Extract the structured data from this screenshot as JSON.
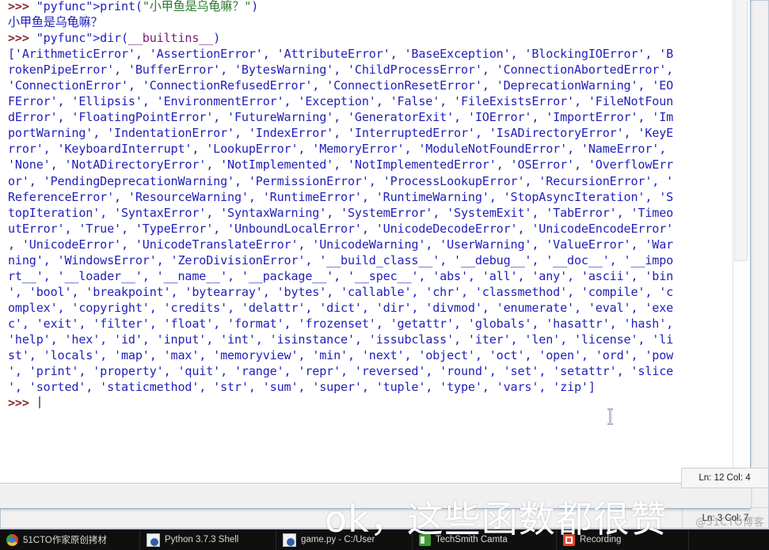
{
  "window": {
    "title": "Python 3.7.3 Shell",
    "status_main": "Ln: 12 Col: 4",
    "status_background": "Ln: 3 Col: 7"
  },
  "shell": {
    "lines": [
      {
        "id": "l1",
        "kind": "input",
        "prompt": ">>> ",
        "text": "print(\"小甲鱼是乌龟嘛？\")"
      },
      {
        "id": "l2",
        "kind": "output",
        "prompt": "",
        "text": "小甲鱼是乌龟嘛？"
      },
      {
        "id": "l3",
        "kind": "input",
        "prompt": ">>> ",
        "text": "dir(__builtins__)"
      },
      {
        "id": "l4",
        "kind": "output",
        "prompt": "",
        "text": "['ArithmeticError', 'AssertionError', 'AttributeError', 'BaseException', 'BlockingIOError', 'B"
      },
      {
        "id": "l5",
        "kind": "output",
        "prompt": "",
        "text": "rokenPipeError', 'BufferError', 'BytesWarning', 'ChildProcessError', 'ConnectionAbortedError',"
      },
      {
        "id": "l6",
        "kind": "output",
        "prompt": "",
        "text": "'ConnectionError', 'ConnectionRefusedError', 'ConnectionResetError', 'DeprecationWarning', 'EO"
      },
      {
        "id": "l7",
        "kind": "output",
        "prompt": "",
        "text": "FError', 'Ellipsis', 'EnvironmentError', 'Exception', 'False', 'FileExistsError', 'FileNotFoun"
      },
      {
        "id": "l8",
        "kind": "output",
        "prompt": "",
        "text": "dError', 'FloatingPointError', 'FutureWarning', 'GeneratorExit', 'IOError', 'ImportError', 'Im"
      },
      {
        "id": "l9",
        "kind": "output",
        "prompt": "",
        "text": "portWarning', 'IndentationError', 'IndexError', 'InterruptedError', 'IsADirectoryError', 'KeyE"
      },
      {
        "id": "l10",
        "kind": "output",
        "prompt": "",
        "text": "rror', 'KeyboardInterrupt', 'LookupError', 'MemoryError', 'ModuleNotFoundError', 'NameError',"
      },
      {
        "id": "l11",
        "kind": "output",
        "prompt": "",
        "text": "'None', 'NotADirectoryError', 'NotImplemented', 'NotImplementedError', 'OSError', 'OverflowErr"
      },
      {
        "id": "l12",
        "kind": "output",
        "prompt": "",
        "text": "or', 'PendingDeprecationWarning', 'PermissionError', 'ProcessLookupError', 'RecursionError', '"
      },
      {
        "id": "l13",
        "kind": "output",
        "prompt": "",
        "text": "ReferenceError', 'ResourceWarning', 'RuntimeError', 'RuntimeWarning', 'StopAsyncIteration', 'S"
      },
      {
        "id": "l14",
        "kind": "output",
        "prompt": "",
        "text": "topIteration', 'SyntaxError', 'SyntaxWarning', 'SystemError', 'SystemExit', 'TabError', 'Timeo"
      },
      {
        "id": "l15",
        "kind": "output",
        "prompt": "",
        "text": "utError', 'True', 'TypeError', 'UnboundLocalError', 'UnicodeDecodeError', 'UnicodeEncodeError'"
      },
      {
        "id": "l16",
        "kind": "output",
        "prompt": "",
        "text": ", 'UnicodeError', 'UnicodeTranslateError', 'UnicodeWarning', 'UserWarning', 'ValueError', 'War"
      },
      {
        "id": "l17",
        "kind": "output",
        "prompt": "",
        "text": "ning', 'WindowsError', 'ZeroDivisionError', '__build_class__', '__debug__', '__doc__', '__impo"
      },
      {
        "id": "l18",
        "kind": "output",
        "prompt": "",
        "text": "rt__', '__loader__', '__name__', '__package__', '__spec__', 'abs', 'all', 'any', 'ascii', 'bin"
      },
      {
        "id": "l19",
        "kind": "output",
        "prompt": "",
        "text": "', 'bool', 'breakpoint', 'bytearray', 'bytes', 'callable', 'chr', 'classmethod', 'compile', 'c"
      },
      {
        "id": "l20",
        "kind": "output",
        "prompt": "",
        "text": "omplex', 'copyright', 'credits', 'delattr', 'dict', 'dir', 'divmod', 'enumerate', 'eval', 'exe"
      },
      {
        "id": "l21",
        "kind": "output",
        "prompt": "",
        "text": "c', 'exit', 'filter', 'float', 'format', 'frozenset', 'getattr', 'globals', 'hasattr', 'hash',"
      },
      {
        "id": "l22",
        "kind": "output",
        "prompt": "",
        "text": "'help', 'hex', 'id', 'input', 'int', 'isinstance', 'issubclass', 'iter', 'len', 'license', 'li"
      },
      {
        "id": "l23",
        "kind": "output",
        "prompt": "",
        "text": "st', 'locals', 'map', 'max', 'memoryview', 'min', 'next', 'object', 'oct', 'open', 'ord', 'pow"
      },
      {
        "id": "l24",
        "kind": "output",
        "prompt": "",
        "text": "', 'print', 'property', 'quit', 'range', 'repr', 'reversed', 'round', 'set', 'setattr', 'slice"
      },
      {
        "id": "l25",
        "kind": "output",
        "prompt": "",
        "text": "', 'sorted', 'staticmethod', 'str', 'sum', 'super', 'tuple', 'type', 'vars', 'zip']"
      },
      {
        "id": "l26",
        "kind": "input",
        "prompt": ">>> ",
        "text": ""
      }
    ],
    "scroll_arrow_down": "⌄"
  },
  "taskbar": {
    "items": [
      {
        "label": "51CTO作家原创拷材",
        "icon": "chrome-icon"
      },
      {
        "label": "Python 3.7.3 Shell",
        "icon": "python-file-icon"
      },
      {
        "label": "game.py - C:/User",
        "icon": "python-file-icon"
      },
      {
        "label": "TechSmith Camta",
        "icon": "camtasia-icon"
      },
      {
        "label": "Recording",
        "icon": "recording-icon"
      }
    ]
  },
  "overlay": {
    "subtitle": "ok，这些函数都很赞",
    "watermark": "@51CTO博客"
  },
  "colors": {
    "prompt": "#8b2b2b",
    "output": "#1f1fbb",
    "string": "#2f7a2f",
    "builtin": "#7a1a7a",
    "shell_bg": "#ffffff",
    "taskbar_bg": "#0f0f0f"
  }
}
